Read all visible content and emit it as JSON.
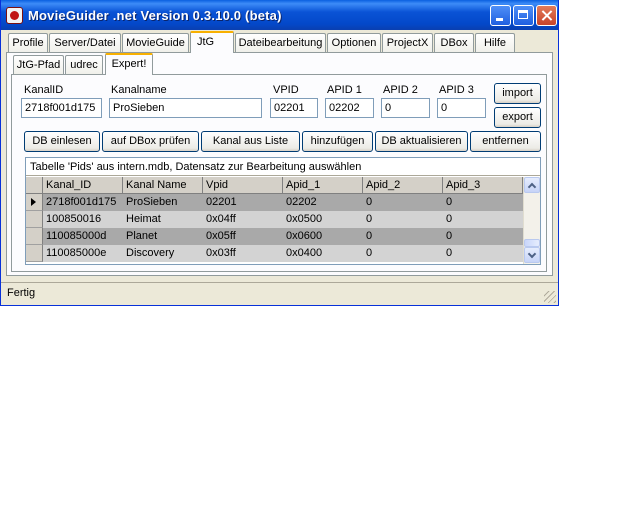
{
  "window": {
    "title": "MovieGuider .net Version 0.3.10.0 (beta)"
  },
  "main_tabs": [
    "Profile",
    "Server/Datei",
    "MovieGuide",
    "JtG",
    "Dateibearbeitung",
    "Optionen",
    "ProjectX",
    "DBox",
    "Hilfe"
  ],
  "active_main_tab": "JtG",
  "sub_tabs": [
    "JtG-Pfad",
    "udrec",
    "Expert!"
  ],
  "active_sub_tab": "Expert!",
  "fields": {
    "kanalid": {
      "label": "KanalID",
      "value": "2718f001d175"
    },
    "kanalname": {
      "label": "Kanalname",
      "value": "ProSieben"
    },
    "vpid": {
      "label": "VPID",
      "value": "02201"
    },
    "apid1": {
      "label": "APID 1",
      "value": "02202"
    },
    "apid2": {
      "label": "APID 2",
      "value": "0"
    },
    "apid3": {
      "label": "APID 3",
      "value": "0"
    }
  },
  "side_buttons": {
    "import": "import",
    "export": "export"
  },
  "action_buttons": [
    "DB einlesen",
    "auf DBox prüfen",
    "Kanal aus Liste",
    "hinzufügen",
    "DB aktualisieren",
    "entfernen"
  ],
  "table": {
    "caption": "Tabelle 'Pids' aus intern.mdb, Datensatz zur Bearbeitung auswählen",
    "columns": [
      "Kanal_ID",
      "Kanal Name",
      "Vpid",
      "Apid_1",
      "Apid_2",
      "Apid_3"
    ],
    "rows": [
      [
        "2718f001d175",
        "ProSieben",
        "02201",
        "02202",
        "0",
        "0"
      ],
      [
        "100850016",
        "Heimat",
        "0x04ff",
        "0x0500",
        "0",
        "0"
      ],
      [
        "110085000d",
        "Planet",
        "0x05ff",
        "0x0600",
        "0",
        "0"
      ],
      [
        "110085000e",
        "Discovery",
        "0x03ff",
        "0x0400",
        "0",
        "0"
      ]
    ],
    "selected_row": 0
  },
  "status": "Fertig",
  "colors": {
    "titlebar": "#0a53d6",
    "selected_row": "#a9a9a9",
    "row_light": "#d3d3d3",
    "row_dark": "#a9a9a9"
  }
}
